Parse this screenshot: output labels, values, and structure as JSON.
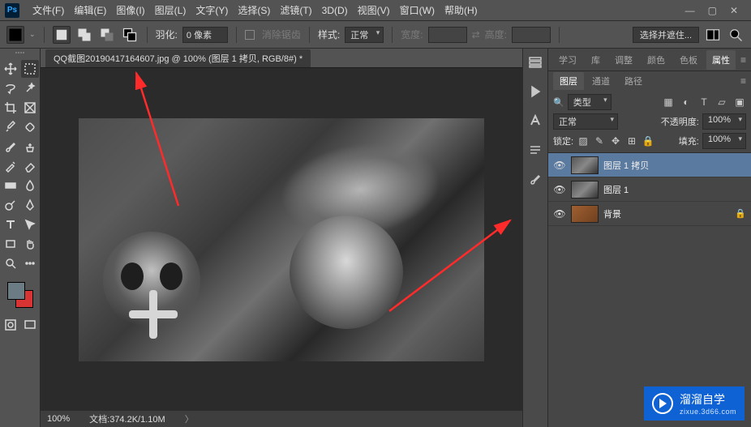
{
  "menu": {
    "items": [
      "文件(F)",
      "编辑(E)",
      "图像(I)",
      "图层(L)",
      "文字(Y)",
      "选择(S)",
      "滤镜(T)",
      "3D(D)",
      "视图(V)",
      "窗口(W)",
      "帮助(H)"
    ]
  },
  "options": {
    "feather_label": "羽化:",
    "feather_value": "0 像素",
    "antialias": "消除锯齿",
    "style_label": "样式:",
    "style_value": "正常",
    "width_label": "宽度:",
    "height_label": "高度:",
    "mask_btn": "选择并遮住..."
  },
  "document": {
    "tab": "QQ截图20190417164607.jpg @ 100% (图层 1 拷贝, RGB/8#) *",
    "zoom": "100%",
    "docinfo": "文档:374.2K/1.10M"
  },
  "panels_top": {
    "items": [
      "学习",
      "库",
      "调整",
      "颜色",
      "色板",
      "属性"
    ],
    "active": 5
  },
  "panels_layers": {
    "tabs": [
      "图层",
      "通道",
      "路径"
    ],
    "active": 0,
    "filter": "类型",
    "blend": "正常",
    "opacity_label": "不透明度:",
    "opacity_value": "100%",
    "lock_label": "锁定:",
    "fill_label": "填充:",
    "fill_value": "100%",
    "layers": [
      {
        "name": "图层 1 拷贝",
        "sel": true
      },
      {
        "name": "图层 1",
        "sel": false
      },
      {
        "name": "背景",
        "sel": false,
        "locked": true,
        "bg": true
      }
    ]
  },
  "tool_names": [
    "move",
    "marquee",
    "lasso",
    "magic-wand",
    "crop",
    "eyedropper",
    "healing",
    "brush",
    "clone",
    "history-brush",
    "eraser",
    "gradient",
    "blur",
    "dodge",
    "pen",
    "type",
    "path-select",
    "rectangle",
    "hand",
    "zoom"
  ],
  "watermark": {
    "brand": "溜溜自学",
    "url": "zixue.3d66.com"
  }
}
